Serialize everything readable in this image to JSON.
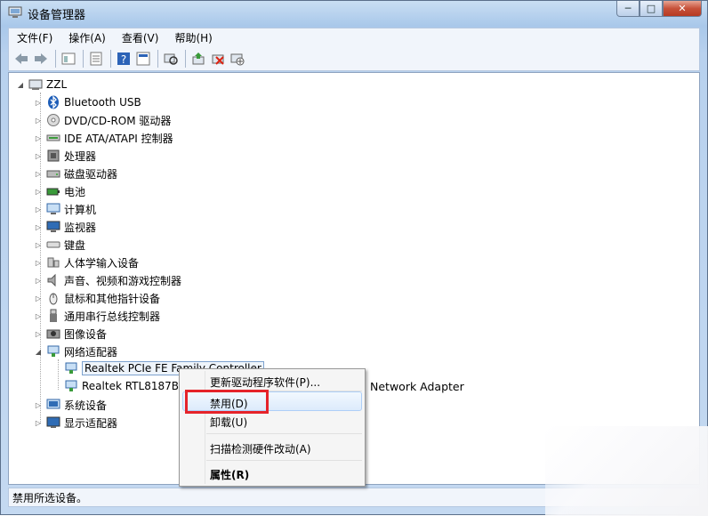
{
  "window": {
    "title": "设备管理器",
    "controls": {
      "minimize": "─",
      "maximize": "□",
      "close": "✕"
    }
  },
  "menu": [
    "文件(F)",
    "操作(A)",
    "查看(V)",
    "帮助(H)"
  ],
  "toolbar": [
    "back-icon",
    "forward-icon",
    "up-icon",
    "properties-icon",
    "help-icon",
    "console-icon",
    "scan-icon",
    "update-driver-icon",
    "uninstall-icon",
    "disable-icon"
  ],
  "tree": {
    "root": "ZZL",
    "categories": [
      {
        "label": "Bluetooth USB",
        "icon": "bluetooth-icon"
      },
      {
        "label": "DVD/CD-ROM 驱动器",
        "icon": "dvd-icon"
      },
      {
        "label": "IDE ATA/ATAPI 控制器",
        "icon": "ide-icon"
      },
      {
        "label": "处理器",
        "icon": "processor-icon"
      },
      {
        "label": "磁盘驱动器",
        "icon": "disk-icon"
      },
      {
        "label": "电池",
        "icon": "battery-icon"
      },
      {
        "label": "计算机",
        "icon": "computer-icon"
      },
      {
        "label": "监视器",
        "icon": "monitor-icon"
      },
      {
        "label": "键盘",
        "icon": "keyboard-icon"
      },
      {
        "label": "人体学输入设备",
        "icon": "hid-icon"
      },
      {
        "label": "声音、视频和游戏控制器",
        "icon": "sound-icon"
      },
      {
        "label": "鼠标和其他指针设备",
        "icon": "mouse-icon"
      },
      {
        "label": "通用串行总线控制器",
        "icon": "usb-icon"
      },
      {
        "label": "图像设备",
        "icon": "imaging-icon"
      },
      {
        "label": "网络适配器",
        "icon": "network-icon"
      }
    ],
    "network_children": [
      "Realtek PCIe FE Family Controller",
      "Realtek RTL8187B"
    ],
    "network_child_suffix": "Network Adapter",
    "after": [
      {
        "label": "系统设备",
        "icon": "system-icon"
      },
      {
        "label": "显示适配器",
        "icon": "display-icon"
      }
    ]
  },
  "context_menu": {
    "update": "更新驱动程序软件(P)...",
    "disable": "禁用(D)",
    "uninstall": "卸载(U)",
    "scan": "扫描检测硬件改动(A)",
    "properties": "属性(R)"
  },
  "status": "禁用所选设备。",
  "colors": {
    "highlight": "#e5232a",
    "hover": "#dcebfc"
  }
}
